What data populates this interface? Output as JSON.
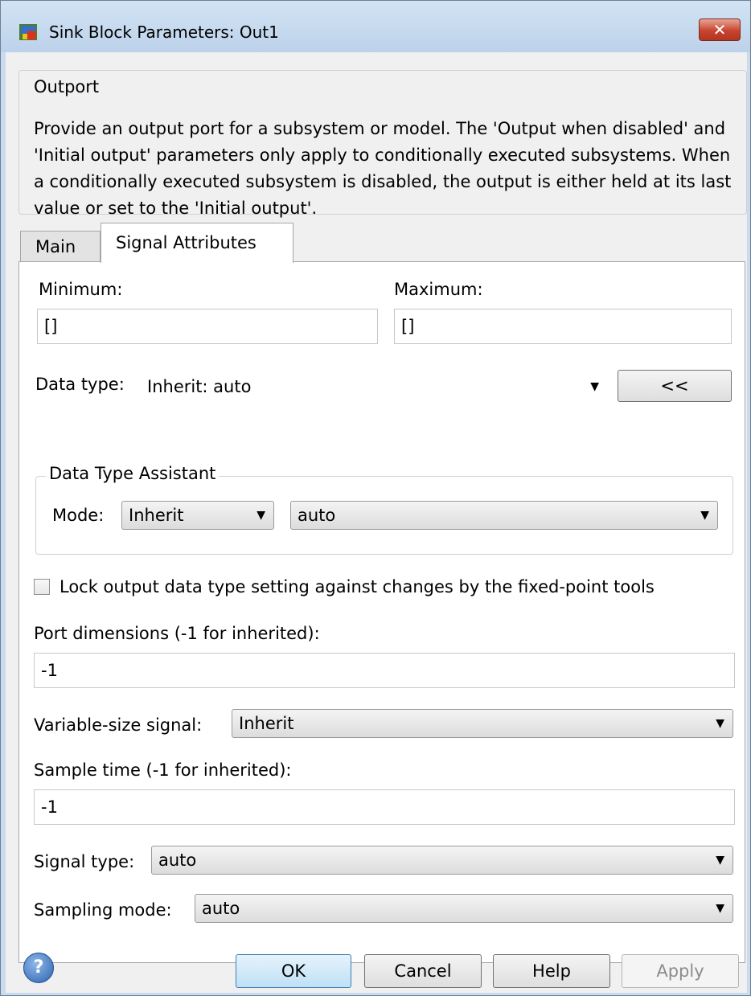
{
  "window": {
    "title": "Sink Block Parameters: Out1",
    "close_glyph": "✕"
  },
  "outport": {
    "legend": "Outport",
    "description": "Provide an output port for a subsystem or model.  The 'Output when disabled' and 'Initial output' parameters only apply to conditionally executed subsystems. When a conditionally executed subsystem is disabled, the output is either held at its last value or set to the 'Initial output'."
  },
  "tabs": [
    {
      "label": "Main",
      "active": false
    },
    {
      "label": "Signal Attributes",
      "active": true
    }
  ],
  "signal_attributes": {
    "minimum_label": "Minimum:",
    "minimum_value": "[]",
    "maximum_label": "Maximum:",
    "maximum_value": "[]",
    "data_type_label": "Data type:",
    "data_type_value": "Inherit: auto",
    "data_type_assistant_button": "<<",
    "assistant_legend": "Data Type Assistant",
    "mode_label": "Mode:",
    "mode_value": "Inherit",
    "mode_sub_value": "auto",
    "lock_label": "Lock output data type setting against changes by the fixed-point tools",
    "lock_checked": false,
    "port_dim_label": "Port dimensions (-1 for inherited):",
    "port_dim_value": "-1",
    "var_size_label": "Variable-size signal:",
    "var_size_value": "Inherit",
    "sample_time_label": "Sample time (-1 for inherited):",
    "sample_time_value": "-1",
    "signal_type_label": "Signal type:",
    "signal_type_value": "auto",
    "sampling_mode_label": "Sampling mode:",
    "sampling_mode_value": "auto"
  },
  "footer": {
    "help_glyph": "?",
    "ok": "OK",
    "cancel": "Cancel",
    "help": "Help",
    "apply": "Apply"
  },
  "glyphs": {
    "dropdown": "▼"
  },
  "colors": {
    "titlebar": "#c9dbef",
    "ok_accent": "#3c7fb1",
    "close_button": "#c8442f"
  }
}
